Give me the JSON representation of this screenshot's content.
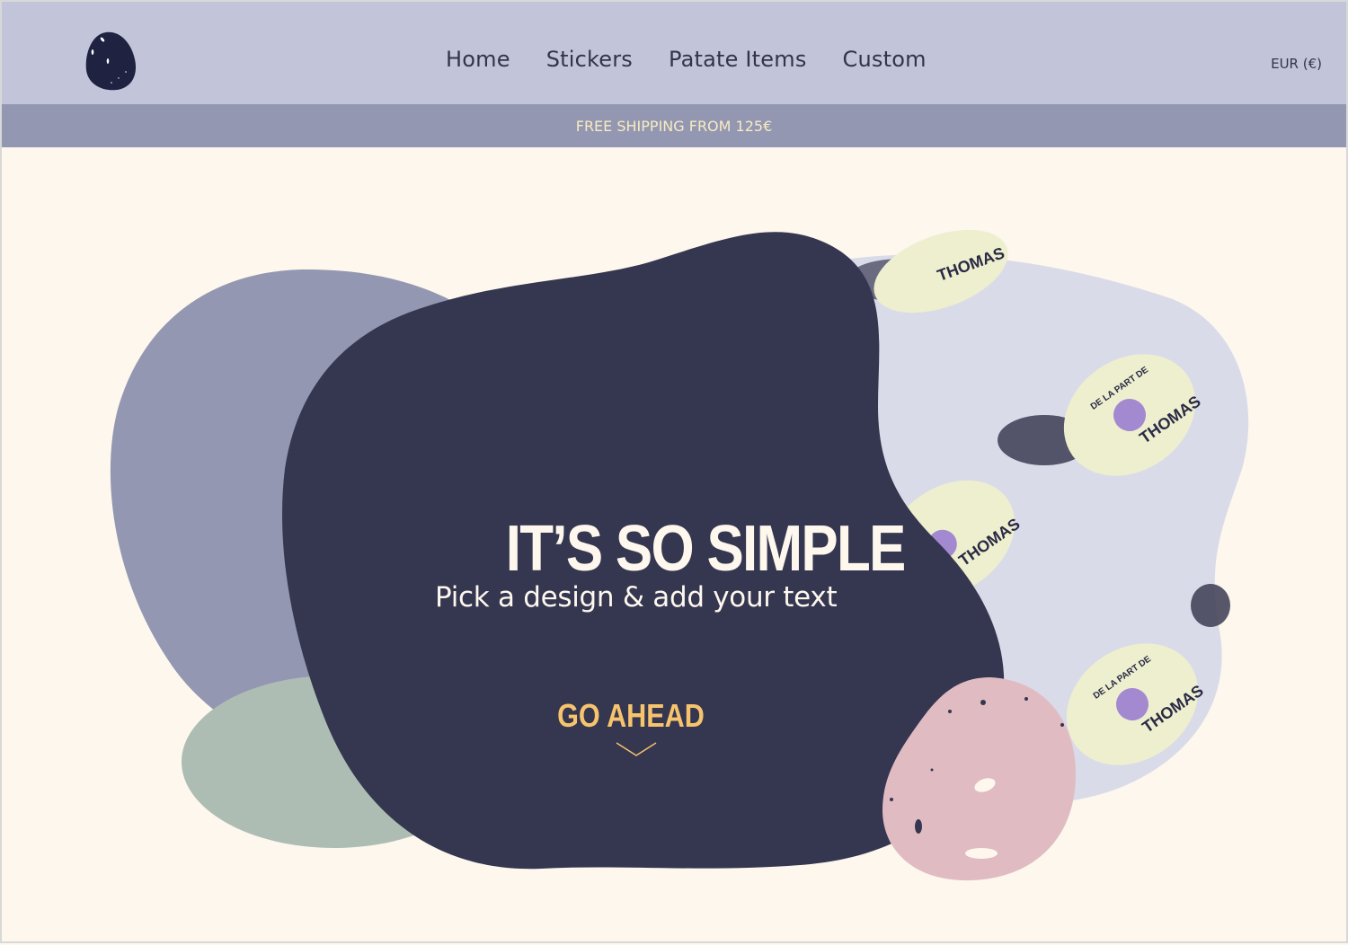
{
  "header": {
    "logo_icon": "potato-logo",
    "nav": [
      {
        "label": "Home"
      },
      {
        "label": "Stickers"
      },
      {
        "label": "Patate Items"
      },
      {
        "label": "Custom"
      }
    ],
    "currency": "EUR (€)"
  },
  "banner": {
    "text": "FREE SHIPPING FROM 125€"
  },
  "hero": {
    "title": "IT’S SO SIMPLE",
    "subtitle": "Pick a design & add your text",
    "cta_label": "GO AHEAD",
    "cta_icon": "chevron-down-icon",
    "sticker_top_text": "DE LA PART DE",
    "sticker_name": "THOMAS"
  },
  "colors": {
    "header_bg": "#c2c5d9",
    "banner_bg": "#9497b1",
    "page_bg": "#fdf7ee",
    "navy_blob": "#35364f",
    "cta": "#f7c46e",
    "pink_potato": "#e0bcc2",
    "sage": "#adbdb3"
  }
}
